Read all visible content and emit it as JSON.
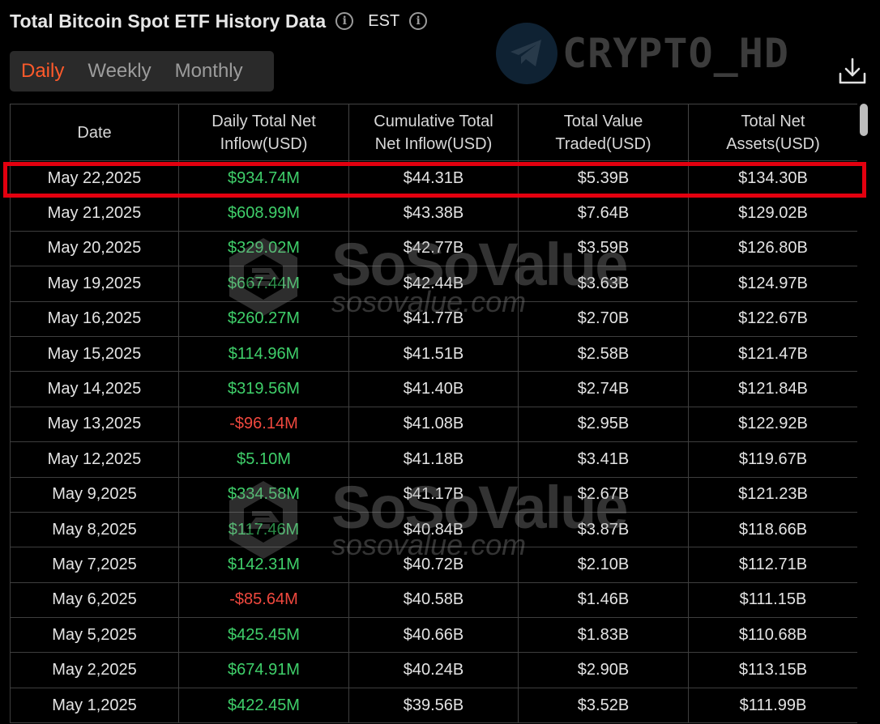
{
  "header": {
    "title": "Total Bitcoin Spot ETF History Data",
    "timezone": "EST"
  },
  "tabs": [
    {
      "label": "Daily",
      "active": true
    },
    {
      "label": "Weekly",
      "active": false
    },
    {
      "label": "Monthly",
      "active": false
    }
  ],
  "watermarks": {
    "top": "CRYPTO_HD",
    "brand": "SoSoValue",
    "url": "sosovalue.com"
  },
  "colors": {
    "positive": "#3fcf6a",
    "negative": "#f0483e",
    "active_tab": "#ff5a2b",
    "highlight": "#e3000f"
  },
  "table": {
    "columns": [
      {
        "line1": "Date",
        "line2": ""
      },
      {
        "line1": "Daily Total Net",
        "line2": "Inflow(USD)"
      },
      {
        "line1": "Cumulative Total",
        "line2": "Net Inflow(USD)"
      },
      {
        "line1": "Total Value",
        "line2": "Traded(USD)"
      },
      {
        "line1": "Total Net",
        "line2": "Assets(USD)"
      }
    ],
    "rows": [
      {
        "date": "May 22,2025",
        "inflow": "$934.74M",
        "sign": "pos",
        "cumulative": "$44.31B",
        "traded": "$5.39B",
        "assets": "$134.30B",
        "highlighted": true
      },
      {
        "date": "May 21,2025",
        "inflow": "$608.99M",
        "sign": "pos",
        "cumulative": "$43.38B",
        "traded": "$7.64B",
        "assets": "$129.02B"
      },
      {
        "date": "May 20,2025",
        "inflow": "$329.02M",
        "sign": "pos",
        "cumulative": "$42.77B",
        "traded": "$3.59B",
        "assets": "$126.80B"
      },
      {
        "date": "May 19,2025",
        "inflow": "$667.44M",
        "sign": "pos",
        "cumulative": "$42.44B",
        "traded": "$3.63B",
        "assets": "$124.97B"
      },
      {
        "date": "May 16,2025",
        "inflow": "$260.27M",
        "sign": "pos",
        "cumulative": "$41.77B",
        "traded": "$2.70B",
        "assets": "$122.67B"
      },
      {
        "date": "May 15,2025",
        "inflow": "$114.96M",
        "sign": "pos",
        "cumulative": "$41.51B",
        "traded": "$2.58B",
        "assets": "$121.47B"
      },
      {
        "date": "May 14,2025",
        "inflow": "$319.56M",
        "sign": "pos",
        "cumulative": "$41.40B",
        "traded": "$2.74B",
        "assets": "$121.84B"
      },
      {
        "date": "May 13,2025",
        "inflow": "-$96.14M",
        "sign": "neg",
        "cumulative": "$41.08B",
        "traded": "$2.95B",
        "assets": "$122.92B"
      },
      {
        "date": "May 12,2025",
        "inflow": "$5.10M",
        "sign": "pos",
        "cumulative": "$41.18B",
        "traded": "$3.41B",
        "assets": "$119.67B"
      },
      {
        "date": "May 9,2025",
        "inflow": "$334.58M",
        "sign": "pos",
        "cumulative": "$41.17B",
        "traded": "$2.67B",
        "assets": "$121.23B"
      },
      {
        "date": "May 8,2025",
        "inflow": "$117.46M",
        "sign": "pos",
        "cumulative": "$40.84B",
        "traded": "$3.87B",
        "assets": "$118.66B"
      },
      {
        "date": "May 7,2025",
        "inflow": "$142.31M",
        "sign": "pos",
        "cumulative": "$40.72B",
        "traded": "$2.10B",
        "assets": "$112.71B"
      },
      {
        "date": "May 6,2025",
        "inflow": "-$85.64M",
        "sign": "neg",
        "cumulative": "$40.58B",
        "traded": "$1.46B",
        "assets": "$111.15B"
      },
      {
        "date": "May 5,2025",
        "inflow": "$425.45M",
        "sign": "pos",
        "cumulative": "$40.66B",
        "traded": "$1.83B",
        "assets": "$110.68B"
      },
      {
        "date": "May 2,2025",
        "inflow": "$674.91M",
        "sign": "pos",
        "cumulative": "$40.24B",
        "traded": "$2.90B",
        "assets": "$113.15B"
      },
      {
        "date": "May 1,2025",
        "inflow": "$422.45M",
        "sign": "pos",
        "cumulative": "$39.56B",
        "traded": "$3.52B",
        "assets": "$111.99B"
      }
    ]
  }
}
